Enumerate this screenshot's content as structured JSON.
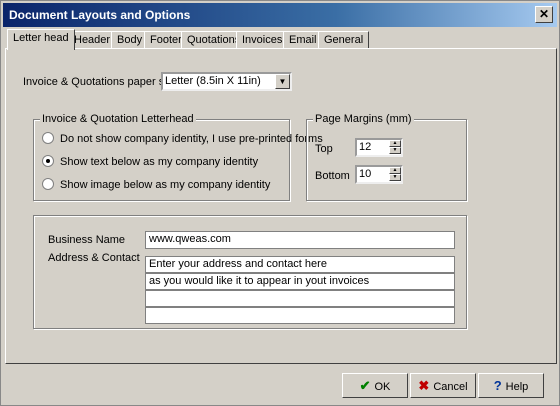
{
  "window": {
    "title": "Document Layouts and Options",
    "close_glyph": "✕"
  },
  "tabs": [
    {
      "label": "Letter head",
      "active": true
    },
    {
      "label": "Header"
    },
    {
      "label": "Body"
    },
    {
      "label": "Footer"
    },
    {
      "label": "Quotations"
    },
    {
      "label": "Invoices"
    },
    {
      "label": "Email"
    },
    {
      "label": "General"
    }
  ],
  "paper": {
    "label": "Invoice & Quotations paper size",
    "value": "Letter (8.5in X 11in)",
    "arrow": "▼"
  },
  "letterhead": {
    "legend": "Invoice & Quotation Letterhead",
    "options": [
      {
        "label": "Do not show company identity, I use pre-printed forms",
        "selected": false
      },
      {
        "label": "Show text below as my company identity",
        "selected": true
      },
      {
        "label": "Show image below as my company identity",
        "selected": false
      }
    ]
  },
  "margins": {
    "legend": "Page Margins (mm)",
    "top_label": "Top",
    "top_value": "12",
    "bottom_label": "Bottom",
    "bottom_value": "10",
    "up": "▲",
    "down": "▼"
  },
  "identity": {
    "business_label": "Business Name",
    "business_value": "www.qweas.com",
    "address_label": "Address & Contact",
    "address_lines": [
      "Enter your address and contact here",
      "as you would like it to appear in yout invoices",
      "",
      "",
      ""
    ]
  },
  "buttons": {
    "ok": {
      "label": "OK",
      "glyph": "✔",
      "color": "#008000"
    },
    "cancel": {
      "label": "Cancel",
      "glyph": "✖",
      "color": "#c00000"
    },
    "help": {
      "label": "Help",
      "glyph": "?",
      "color": "#003399"
    }
  }
}
